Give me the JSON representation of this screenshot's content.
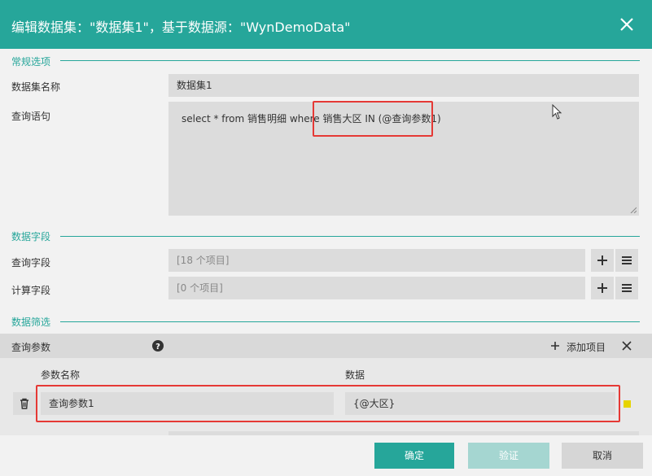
{
  "dialog": {
    "title": "编辑数据集：\"数据集1\"，基于数据源：\"WynDemoData\"",
    "close_icon": "close-icon"
  },
  "general": {
    "section_title": "常规选项",
    "name_label": "数据集名称",
    "name_value": "数据集1",
    "query_label": "查询语句",
    "query_value": "select * from 销售明细 where 销售大区 IN (@查询参数1)"
  },
  "fields": {
    "section_title": "数据字段",
    "query_fields_label": "查询字段",
    "query_fields_value": "[18 个项目]",
    "calc_fields_label": "计算字段",
    "calc_fields_value": "[0 个项目]"
  },
  "filter": {
    "section_title": "数据筛选",
    "params_label": "查询参数",
    "add_item_label": "添加项目",
    "col_name": "参数名称",
    "col_data": "数据",
    "rows": [
      {
        "name": "查询参数1",
        "data": "{@大区}"
      }
    ]
  },
  "footer": {
    "ok_label": "确定",
    "validate_label": "验证",
    "cancel_label": "取消"
  },
  "colors": {
    "accent": "#26a69a",
    "highlight": "#e53935",
    "warning_dot": "#e6d400"
  }
}
